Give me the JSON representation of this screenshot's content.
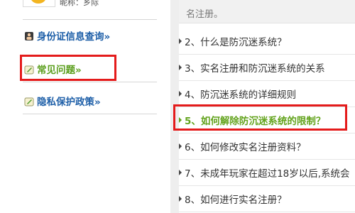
{
  "profile": {
    "nickname_label": "昵称：乡际"
  },
  "sidebar": {
    "items": [
      {
        "label": "身份证信息查询»",
        "icon": "id-card-icon"
      },
      {
        "label": "常见问题»",
        "icon": "pencil-icon"
      },
      {
        "label": "隐私保护政策»",
        "icon": "pencil-icon"
      }
    ]
  },
  "main": {
    "top_text": "名注册。",
    "questions": [
      "2、什么是防沉迷系统？",
      "3、实名注册和防沉迷系统的关系",
      "4、防沉迷系统的详细规则",
      "5、如何解除防沉迷系统的限制？",
      "6、如何修改实名注册资料？",
      "7、未成年玩家在超过18岁以后,系统会",
      "8、如何进行实名注册？"
    ]
  },
  "colors": {
    "link_blue": "#1e5fa8",
    "active_green": "#62a31c",
    "highlight_red": "#e41b1b"
  }
}
